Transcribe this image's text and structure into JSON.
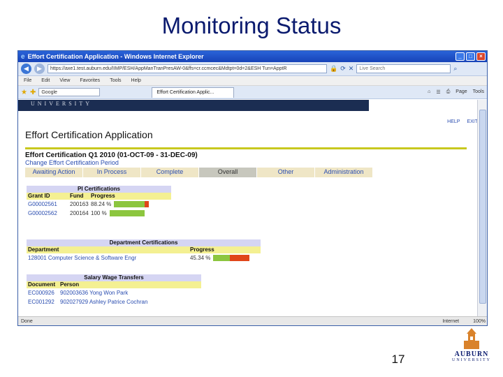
{
  "slide": {
    "title": "Monitoring Status",
    "page_number": "17"
  },
  "logo": {
    "word": "AUBURN",
    "sub": "UNIVERSITY"
  },
  "browser": {
    "window_title": "Effort Certification Application - Windows Internet Explorer",
    "url": "https://axe1.test.auburn.edu/IIMP/ESH/AppManTranPresAW-0&ffs=cr.ccmcec&Mdtpt=0d=2&ESH Tun=ApptR",
    "search_placeholder": "Live Search",
    "menu": [
      "File",
      "Edit",
      "View",
      "Favorites",
      "Tools",
      "Help"
    ],
    "favorites_box": "Google",
    "page_tab": "Effort Certification Applic...",
    "tools": [
      "Page",
      "Tools"
    ],
    "status_left": "Done",
    "status_zone": "Internet",
    "zoom": "100%"
  },
  "app": {
    "band_text": "UNIVERSITY",
    "help": "HELP",
    "exit": "EXIT",
    "title": "Effort Certification Application",
    "period": "Effort Certification Q1 2010 (01-OCT-09 - 31-DEC-09)",
    "change_period": "Change Effort Certification Period",
    "tabs": [
      "Awaiting Action",
      "In Process",
      "Complete",
      "Overall",
      "Other",
      "Administration"
    ],
    "pi": {
      "header": "PI Certifications",
      "col_grant": "Grant ID",
      "col_fund": "Fund",
      "col_progress": "Progress",
      "rows": [
        {
          "grant": "G00002561",
          "fund": "200163",
          "pct": "88.24 %",
          "progress": 0.8824
        },
        {
          "grant": "G00002562",
          "fund": "200164",
          "pct": "100 %",
          "progress": 1.0
        }
      ]
    },
    "dept": {
      "header": "Department Certifications",
      "col_dept": "Department",
      "col_progress": "Progress",
      "rows": [
        {
          "dept": "128001 Computer Science & Software Engr",
          "pct": "45.34 %",
          "progress": 0.4534
        }
      ]
    },
    "wage": {
      "header": "Salary Wage Transfers",
      "col_doc": "Document",
      "col_person": "Person",
      "rows": [
        {
          "doc": "EC000926",
          "person": "902003636 Yong Won Park"
        },
        {
          "doc": "EC001292",
          "person": "902027929 Ashley Patrice Cochran"
        }
      ]
    }
  },
  "colors": {
    "bar_done": "#8cc63f",
    "bar_todo": "#e0461a",
    "title": "#0a1a6e"
  }
}
